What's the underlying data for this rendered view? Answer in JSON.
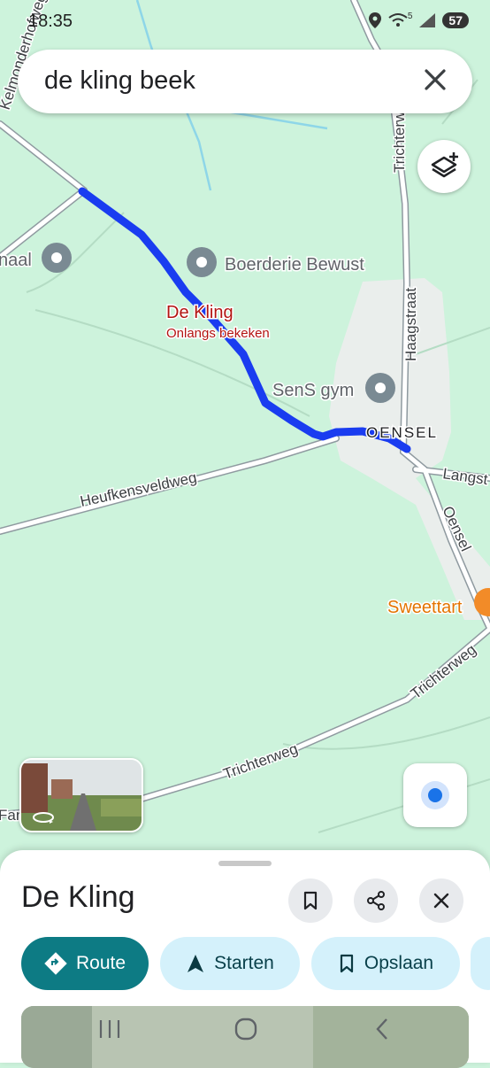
{
  "status_bar": {
    "time": "18:35",
    "battery": "57",
    "signal_label": "5"
  },
  "search": {
    "query": "de kling beek",
    "clear_icon": "close-icon"
  },
  "map": {
    "selected_place": {
      "name": "De Kling",
      "subtitle": "Onlangs bekeken"
    },
    "places": {
      "boerderie": "Boerderie Bewust",
      "gym": "SenS gym",
      "naal": "naal",
      "sweettart": "Sweettart",
      "oensel": "OENSEL"
    },
    "roads": {
      "heufkensveldweg": "Heufkensveldweg",
      "trichterweg": "Trichterweg",
      "trichterweg2": "Trichterweg",
      "haagstraat": "Haagstraat",
      "oensel_road": "Oensel",
      "langst": "Langst",
      "kelmonderhofweg": "Kelmonderhofweg",
      "terweg": "Trichterweg",
      "fan": "Fan"
    }
  },
  "sheet": {
    "title": "De Kling",
    "actions": {
      "route": "Route",
      "start": "Starten",
      "save": "Opslaan"
    }
  },
  "colors": {
    "map_bg": "#cdf3dc",
    "route": "#1a3cf0",
    "road": "#ffffff",
    "accent": "#0d7b84",
    "chip": "#d4f1fb",
    "place_label_red": "#b31412"
  }
}
